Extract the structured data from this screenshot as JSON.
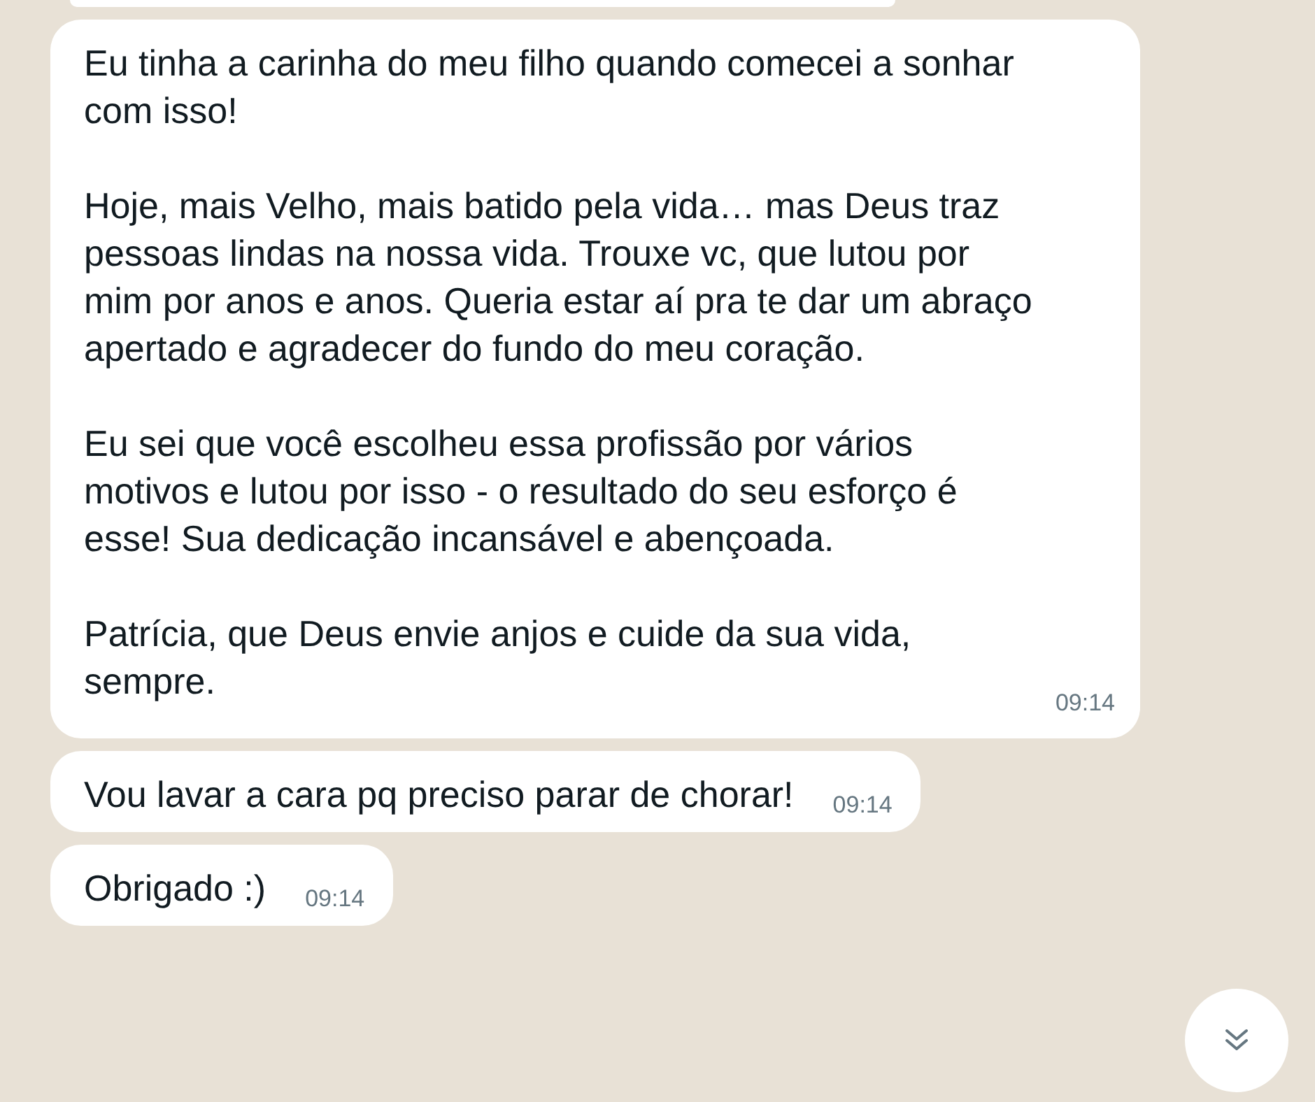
{
  "messages": [
    {
      "paragraphs": [
        "Eu tinha a carinha do meu filho quando comecei a sonhar com isso!",
        "Hoje, mais Velho, mais batido pela vida… mas Deus traz pessoas lindas na nossa vida. Trouxe vc, que lutou por mim por anos e anos. Queria estar aí pra te dar um abraço apertado e agradecer do fundo do meu coração.",
        "Eu sei que você escolheu essa profissão por vários motivos e lutou por isso - o resultado do seu esforço é esse! Sua dedicação incansável e abençoada.",
        "Patrícia, que Deus envie anjos e cuide da sua vida, sempre."
      ],
      "time": "09:14"
    },
    {
      "paragraphs": [
        "Vou lavar a cara pq preciso parar de chorar!"
      ],
      "time": "09:14"
    },
    {
      "paragraphs": [
        "Obrigado :)"
      ],
      "time": "09:14"
    }
  ]
}
